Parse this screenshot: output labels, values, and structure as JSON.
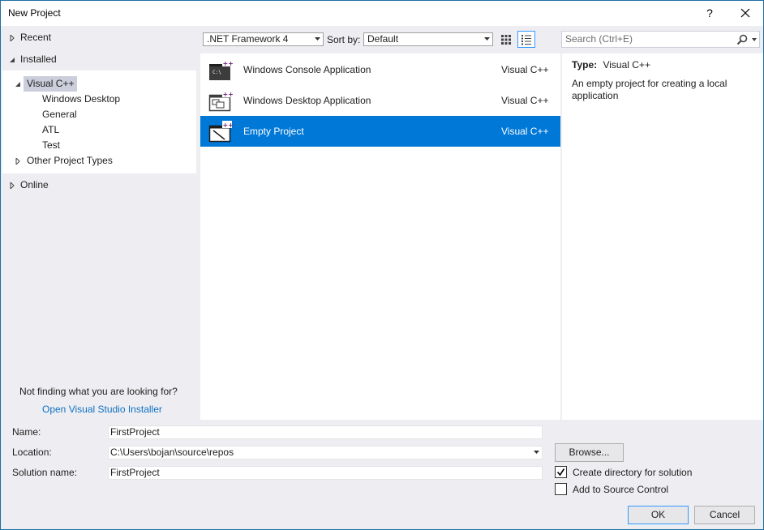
{
  "window": {
    "title": "New Project",
    "help_glyph": "?",
    "close_icon": "close-icon"
  },
  "tree": {
    "recent": "Recent",
    "installed": "Installed",
    "visual_cpp": "Visual C++",
    "children": [
      "Windows Desktop",
      "General",
      "ATL",
      "Test"
    ],
    "other_project_types": "Other Project Types",
    "online": "Online"
  },
  "help": {
    "not_finding": "Not finding what you are looking for?",
    "installer_link": "Open Visual Studio Installer"
  },
  "toolbar": {
    "framework": ".NET Framework 4",
    "sort_by_label": "Sort by:",
    "sort_value": "Default",
    "search_placeholder": "Search (Ctrl+E)"
  },
  "templates": [
    {
      "name": "Windows Console Application",
      "language": "Visual C++",
      "icon": "console-app-icon"
    },
    {
      "name": "Windows Desktop Application",
      "language": "Visual C++",
      "icon": "desktop-app-icon"
    },
    {
      "name": "Empty Project",
      "language": "Visual C++",
      "icon": "empty-project-icon",
      "selected": true
    }
  ],
  "description": {
    "type_label": "Type:",
    "type_value": "Visual C++",
    "text": "An empty project for creating a local application"
  },
  "form": {
    "name_label": "Name:",
    "name_value": "FirstProject",
    "location_label": "Location:",
    "location_value": "C:\\Users\\bojan\\source\\repos",
    "solution_label": "Solution name:",
    "solution_value": "FirstProject",
    "browse_label": "Browse...",
    "create_dir_label": "Create directory for solution",
    "create_dir_checked": true,
    "source_control_label": "Add to Source Control",
    "source_control_checked": false,
    "ok_label": "OK",
    "cancel_label": "Cancel"
  },
  "colors": {
    "selection": "#0078d7",
    "link": "#0e70c0",
    "chrome": "#eeeef2",
    "accent_border": "#3399ff"
  }
}
